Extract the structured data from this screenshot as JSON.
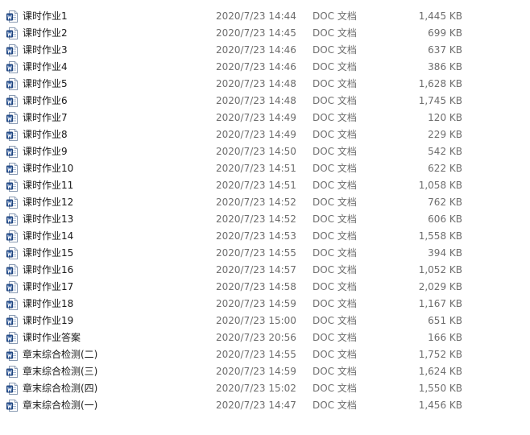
{
  "icons": {
    "file_icon": "word-document-icon",
    "accent": "#2b579a"
  },
  "files": [
    {
      "name": "课时作业1",
      "date": "2020/7/23 14:44",
      "type": "DOC 文档",
      "size": "1,445 KB"
    },
    {
      "name": "课时作业2",
      "date": "2020/7/23 14:45",
      "type": "DOC 文档",
      "size": "699 KB"
    },
    {
      "name": "课时作业3",
      "date": "2020/7/23 14:46",
      "type": "DOC 文档",
      "size": "637 KB"
    },
    {
      "name": "课时作业4",
      "date": "2020/7/23 14:46",
      "type": "DOC 文档",
      "size": "386 KB"
    },
    {
      "name": "课时作业5",
      "date": "2020/7/23 14:48",
      "type": "DOC 文档",
      "size": "1,628 KB"
    },
    {
      "name": "课时作业6",
      "date": "2020/7/23 14:48",
      "type": "DOC 文档",
      "size": "1,745 KB"
    },
    {
      "name": "课时作业7",
      "date": "2020/7/23 14:49",
      "type": "DOC 文档",
      "size": "120 KB"
    },
    {
      "name": "课时作业8",
      "date": "2020/7/23 14:49",
      "type": "DOC 文档",
      "size": "229 KB"
    },
    {
      "name": "课时作业9",
      "date": "2020/7/23 14:50",
      "type": "DOC 文档",
      "size": "542 KB"
    },
    {
      "name": "课时作业10",
      "date": "2020/7/23 14:51",
      "type": "DOC 文档",
      "size": "622 KB"
    },
    {
      "name": "课时作业11",
      "date": "2020/7/23 14:51",
      "type": "DOC 文档",
      "size": "1,058 KB"
    },
    {
      "name": "课时作业12",
      "date": "2020/7/23 14:52",
      "type": "DOC 文档",
      "size": "762 KB"
    },
    {
      "name": "课时作业13",
      "date": "2020/7/23 14:52",
      "type": "DOC 文档",
      "size": "606 KB"
    },
    {
      "name": "课时作业14",
      "date": "2020/7/23 14:53",
      "type": "DOC 文档",
      "size": "1,558 KB"
    },
    {
      "name": "课时作业15",
      "date": "2020/7/23 14:55",
      "type": "DOC 文档",
      "size": "394 KB"
    },
    {
      "name": "课时作业16",
      "date": "2020/7/23 14:57",
      "type": "DOC 文档",
      "size": "1,052 KB"
    },
    {
      "name": "课时作业17",
      "date": "2020/7/23 14:58",
      "type": "DOC 文档",
      "size": "2,029 KB"
    },
    {
      "name": "课时作业18",
      "date": "2020/7/23 14:59",
      "type": "DOC 文档",
      "size": "1,167 KB"
    },
    {
      "name": "课时作业19",
      "date": "2020/7/23 15:00",
      "type": "DOC 文档",
      "size": "651 KB"
    },
    {
      "name": "课时作业答案",
      "date": "2020/7/23 20:56",
      "type": "DOC 文档",
      "size": "166 KB"
    },
    {
      "name": "章末综合检测(二)",
      "date": "2020/7/23 14:55",
      "type": "DOC 文档",
      "size": "1,752 KB"
    },
    {
      "name": "章末综合检测(三)",
      "date": "2020/7/23 14:59",
      "type": "DOC 文档",
      "size": "1,624 KB"
    },
    {
      "name": "章末综合检测(四)",
      "date": "2020/7/23 15:02",
      "type": "DOC 文档",
      "size": "1,550 KB"
    },
    {
      "name": "章末综合检测(一)",
      "date": "2020/7/23 14:47",
      "type": "DOC 文档",
      "size": "1,456 KB"
    }
  ]
}
